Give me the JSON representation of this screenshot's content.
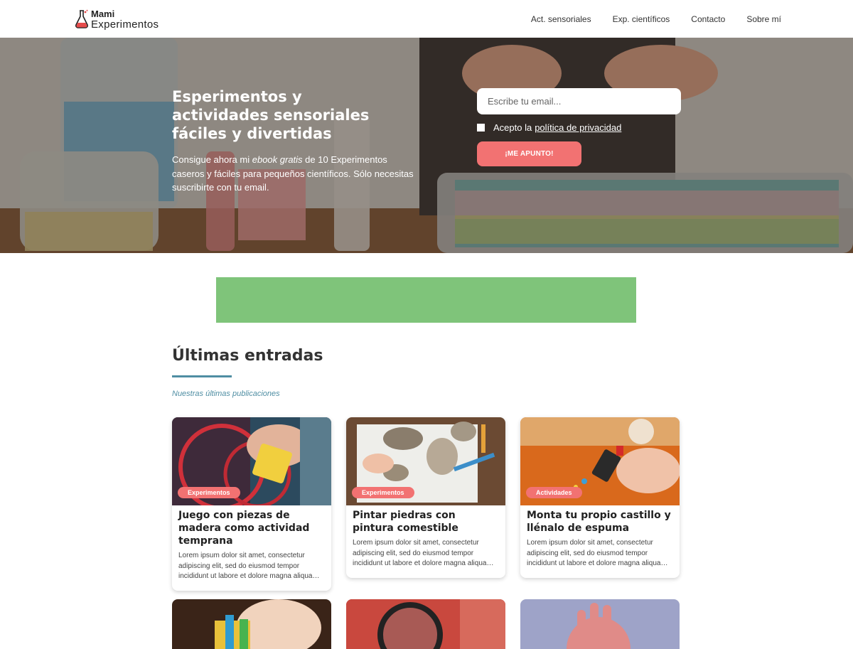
{
  "header": {
    "logo_line1": "Mami",
    "logo_line2": "Experimentos",
    "nav": [
      "Act. sensoriales",
      "Exp. científicos",
      "Contacto",
      "Sobre mí"
    ]
  },
  "hero": {
    "title": "Esperimentos y actividades sensoriales fáciles y divertidas",
    "text_part1": "Consigue ahora mi ",
    "text_em": "ebook gratis",
    "text_part2": " de 10 Experimentos caseros y fáciles para pequeños científicos. Sólo necesitas suscribirte con tu email.",
    "email_placeholder": "Escribe tu email...",
    "consent_text": "Acepto la",
    "consent_link": "política de privacidad",
    "cta": "¡ME APUNTO!"
  },
  "section": {
    "title": "Últimas entradas",
    "subtitle": "Nuestras últimas publicaciones"
  },
  "cards": [
    {
      "badge": "Experimentos",
      "title": "Juego con piezas de madera como actividad temprana",
      "excerpt": "Lorem ipsum dolor sit amet, consectetur adipiscing elit, sed do eiusmod tempor incididunt ut labore et dolore magna aliqua…"
    },
    {
      "badge": "Experimentos",
      "title": "Pintar piedras con pintura comestible",
      "excerpt": "Lorem ipsum dolor sit amet, consectetur adipiscing elit, sed do eiusmod tempor incididunt ut labore et dolore magna aliqua…"
    },
    {
      "badge": "Actividades",
      "title": "Monta tu propio castillo y llénalo de espuma",
      "excerpt": "Lorem ipsum dolor sit amet, consectetur adipiscing elit, sed do eiusmod tempor incididunt ut labore et dolore magna aliqua…"
    }
  ],
  "colors": {
    "accent": "#f27272",
    "teal": "#4f8ea3",
    "ad": "#7fc47a"
  }
}
